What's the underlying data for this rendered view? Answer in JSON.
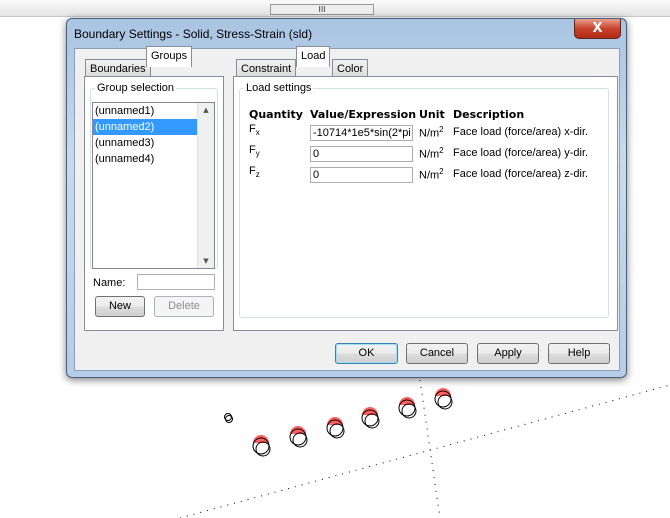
{
  "toolbar": {
    "handle": "III"
  },
  "dialog": {
    "title": "Boundary Settings - Solid, Stress-Strain (sld)",
    "close": "X",
    "left_tabs": [
      {
        "label": "Boundaries",
        "selected": false
      },
      {
        "label": "Groups",
        "selected": true
      }
    ],
    "group_selection": {
      "legend": "Group selection",
      "items": [
        {
          "label": "(unnamed1)",
          "selected": false
        },
        {
          "label": "(unnamed2)",
          "selected": true
        },
        {
          "label": "(unnamed3)",
          "selected": false
        },
        {
          "label": "(unnamed4)",
          "selected": false
        }
      ]
    },
    "name_label": "Name:",
    "name_value": "",
    "new_label": "New",
    "delete_label": "Delete",
    "right_tabs": [
      {
        "label": "Constraint",
        "selected": false
      },
      {
        "label": "Load",
        "selected": true
      },
      {
        "label": "Color",
        "selected": false
      }
    ],
    "load_settings": {
      "legend": "Load settings",
      "headers": {
        "quantity": "Quantity",
        "value": "Value/Expression",
        "unit": "Unit",
        "description": "Description"
      },
      "rows": [
        {
          "q": "F",
          "sub": "x",
          "value": "-10714*1e5*sin(2*pi",
          "unit": "N/m",
          "exp": "2",
          "desc": "Face load (force/area) x-dir."
        },
        {
          "q": "F",
          "sub": "y",
          "value": "0",
          "unit": "N/m",
          "exp": "2",
          "desc": "Face load (force/area) y-dir."
        },
        {
          "q": "F",
          "sub": "z",
          "value": "0",
          "unit": "N/m",
          "exp": "2",
          "desc": "Face load (force/area) z-dir."
        }
      ]
    },
    "buttons": {
      "ok": "OK",
      "cancel": "Cancel",
      "apply": "Apply",
      "help": "Help"
    }
  }
}
